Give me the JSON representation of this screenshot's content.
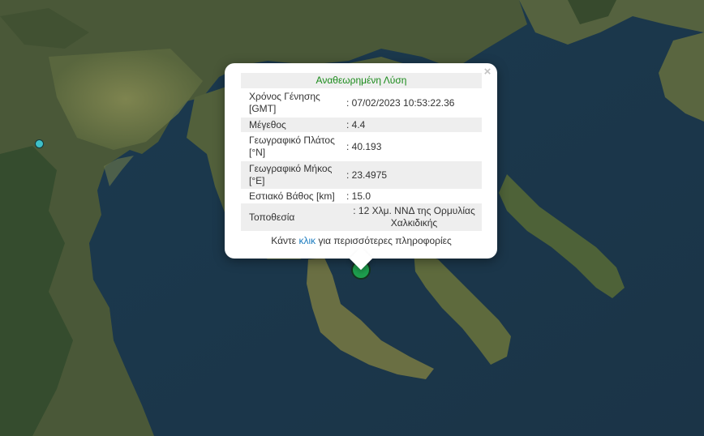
{
  "popup": {
    "close_label": "×",
    "header": "Αναθεωρημένη Λύση",
    "rows": [
      {
        "label": "Χρόνος Γένησης [GMT]",
        "value": ": 07/02/2023 10:53:22.36"
      },
      {
        "label": "Μέγεθος",
        "value": ": 4.4"
      },
      {
        "label": "Γεωγραφικό Πλάτος [°N]",
        "value": ": 40.193"
      },
      {
        "label": "Γεωγραφικό Μήκος [°E]",
        "value": ": 23.4975"
      },
      {
        "label": "Εστιακό Βάθος [km]",
        "value": ": 15.0"
      },
      {
        "label": "Τοποθεσία",
        "value": ": 12 Χλμ. ΝΝΔ της Ορμυλίας Χαλκιδικής"
      }
    ],
    "more_prefix": "Κάντε ",
    "more_link": "κλικ",
    "more_suffix": " για περισσότερες πληροφορίες"
  },
  "markers": [
    {
      "name": "epicenter-marker",
      "color": "#1e9e4e"
    },
    {
      "name": "station-marker",
      "color": "#3fc0c8"
    }
  ],
  "colors": {
    "sea": "#1d3a4d",
    "land": "#4b5a3b",
    "header_text": "#1a8b1a",
    "link": "#1a7bbf"
  }
}
